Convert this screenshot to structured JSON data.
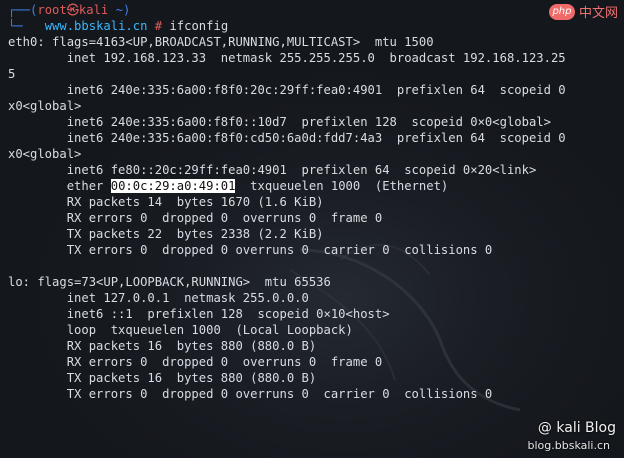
{
  "prompt": {
    "bracket_open": "┌──(",
    "user_host": "root㉿kali",
    "dir": " ~",
    "bracket_close": ")",
    "line2_prefix": "└─",
    "website": "www.bbskali.cn",
    "hash": " # ",
    "command": "ifconfig"
  },
  "lines": [
    "eth0: flags=4163<UP,BROADCAST,RUNNING,MULTICAST>  mtu 1500",
    "        inet 192.168.123.33  netmask 255.255.255.0  broadcast 192.168.123.25",
    "5",
    "        inet6 240e:335:6a00:f8f0:20c:29ff:fea0:4901  prefixlen 64  scopeid 0",
    "x0<global>",
    "        inet6 240e:335:6a00:f8f0::10d7  prefixlen 128  scopeid 0×0<global>",
    "        inet6 240e:335:6a00:f8f0:cd50:6a0d:fdd7:4a3  prefixlen 64  scopeid 0",
    "x0<global>",
    "        inet6 fe80::20c:29ff:fea0:4901  prefixlen 64  scopeid 0×20<link>"
  ],
  "ether": {
    "label": "ether ",
    "mac": "00:0c:29:a0:49:01",
    "rest": "  txqueuelen 1000  (Ethernet)"
  },
  "lines2": [
    "        RX packets 14  bytes 1670 (1.6 KiB)",
    "        RX errors 0  dropped 0  overruns 0  frame 0",
    "        TX packets 22  bytes 2338 (2.2 KiB)",
    "        TX errors 0  dropped 0 overruns 0  carrier 0  collisions 0",
    "",
    "lo: flags=73<UP,LOOPBACK,RUNNING>  mtu 65536",
    "        inet 127.0.0.1  netmask 255.0.0.0",
    "        inet6 ::1  prefixlen 128  scopeid 0×10<host>",
    "        loop  txqueuelen 1000  (Local Loopback)",
    "        RX packets 16  bytes 880 (880.0 B)",
    "        RX errors 0  dropped 0  overruns 0  frame 0",
    "        TX packets 16  bytes 880 (880.0 B)",
    "        TX errors 0  dropped 0 overruns 0  carrier 0  collisions 0"
  ],
  "watermark": {
    "brand": "@ kali Blog",
    "site": "blog.bbskali.cn",
    "php_badge": "php",
    "php_text": "中文网"
  }
}
